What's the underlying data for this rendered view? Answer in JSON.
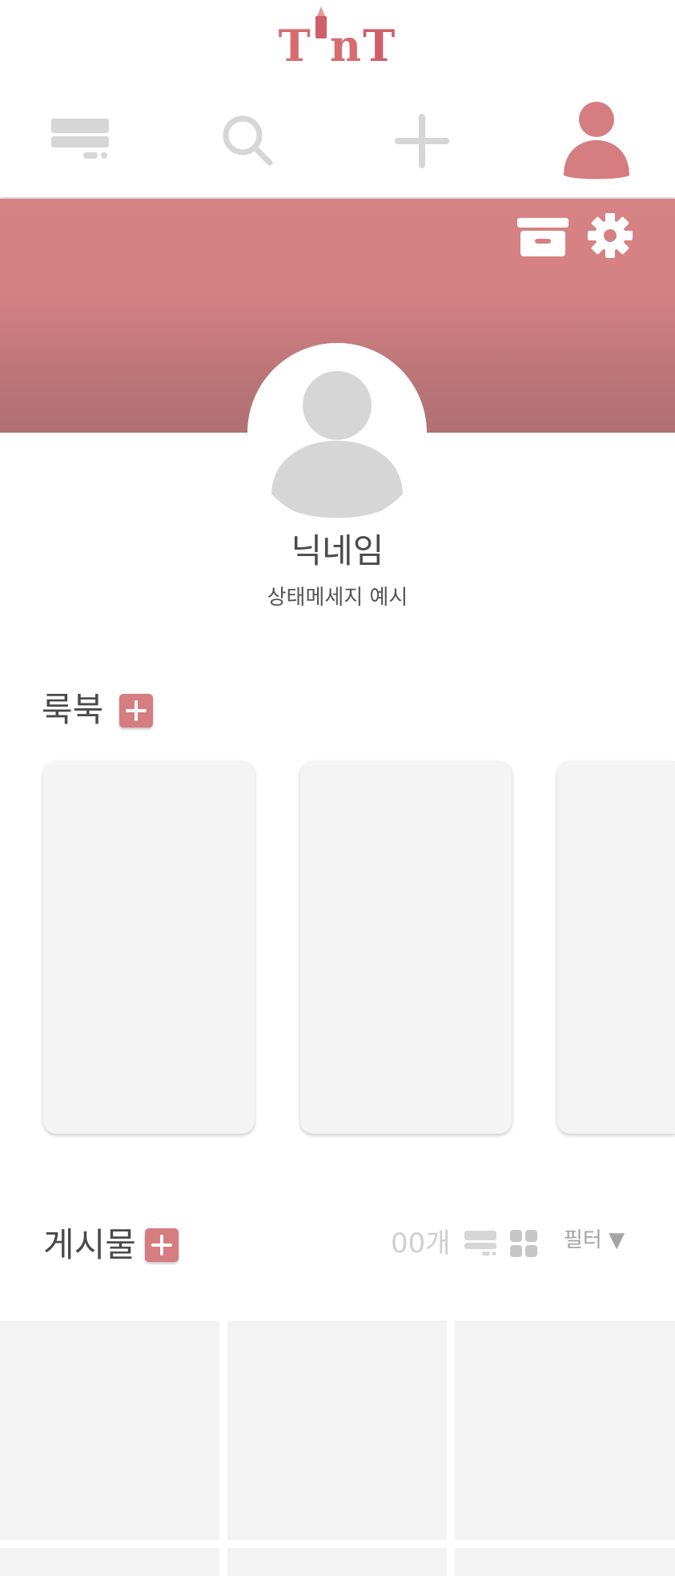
{
  "app": {
    "logo_text_left": "T",
    "logo_text_mid": "n",
    "logo_text_right": "T",
    "logo_icon": "lipstick-icon"
  },
  "nav": {
    "items": [
      {
        "icon": "feed-icon",
        "active": false
      },
      {
        "icon": "search-icon",
        "active": false
      },
      {
        "icon": "plus-icon",
        "active": false
      },
      {
        "icon": "profile-icon",
        "active": true
      }
    ]
  },
  "banner": {
    "archive_icon": "archive-icon",
    "settings_icon": "gear-icon"
  },
  "profile": {
    "nickname": "닉네임",
    "status_message": "상태메세지 예시"
  },
  "lookbook": {
    "title": "룩북",
    "add_icon": "plus-icon"
  },
  "posts": {
    "title": "게시물",
    "add_icon": "plus-icon",
    "count": "00개",
    "view_list_icon": "list-view-icon",
    "view_grid_icon": "grid-view-icon",
    "filter_label": "필터 ▼"
  },
  "colors": {
    "accent": "#d57d80",
    "banner_top": "#d78284",
    "banner_bottom": "#b17173",
    "icon_gray": "#d6d6d6",
    "card_bg": "#f4f4f4"
  }
}
